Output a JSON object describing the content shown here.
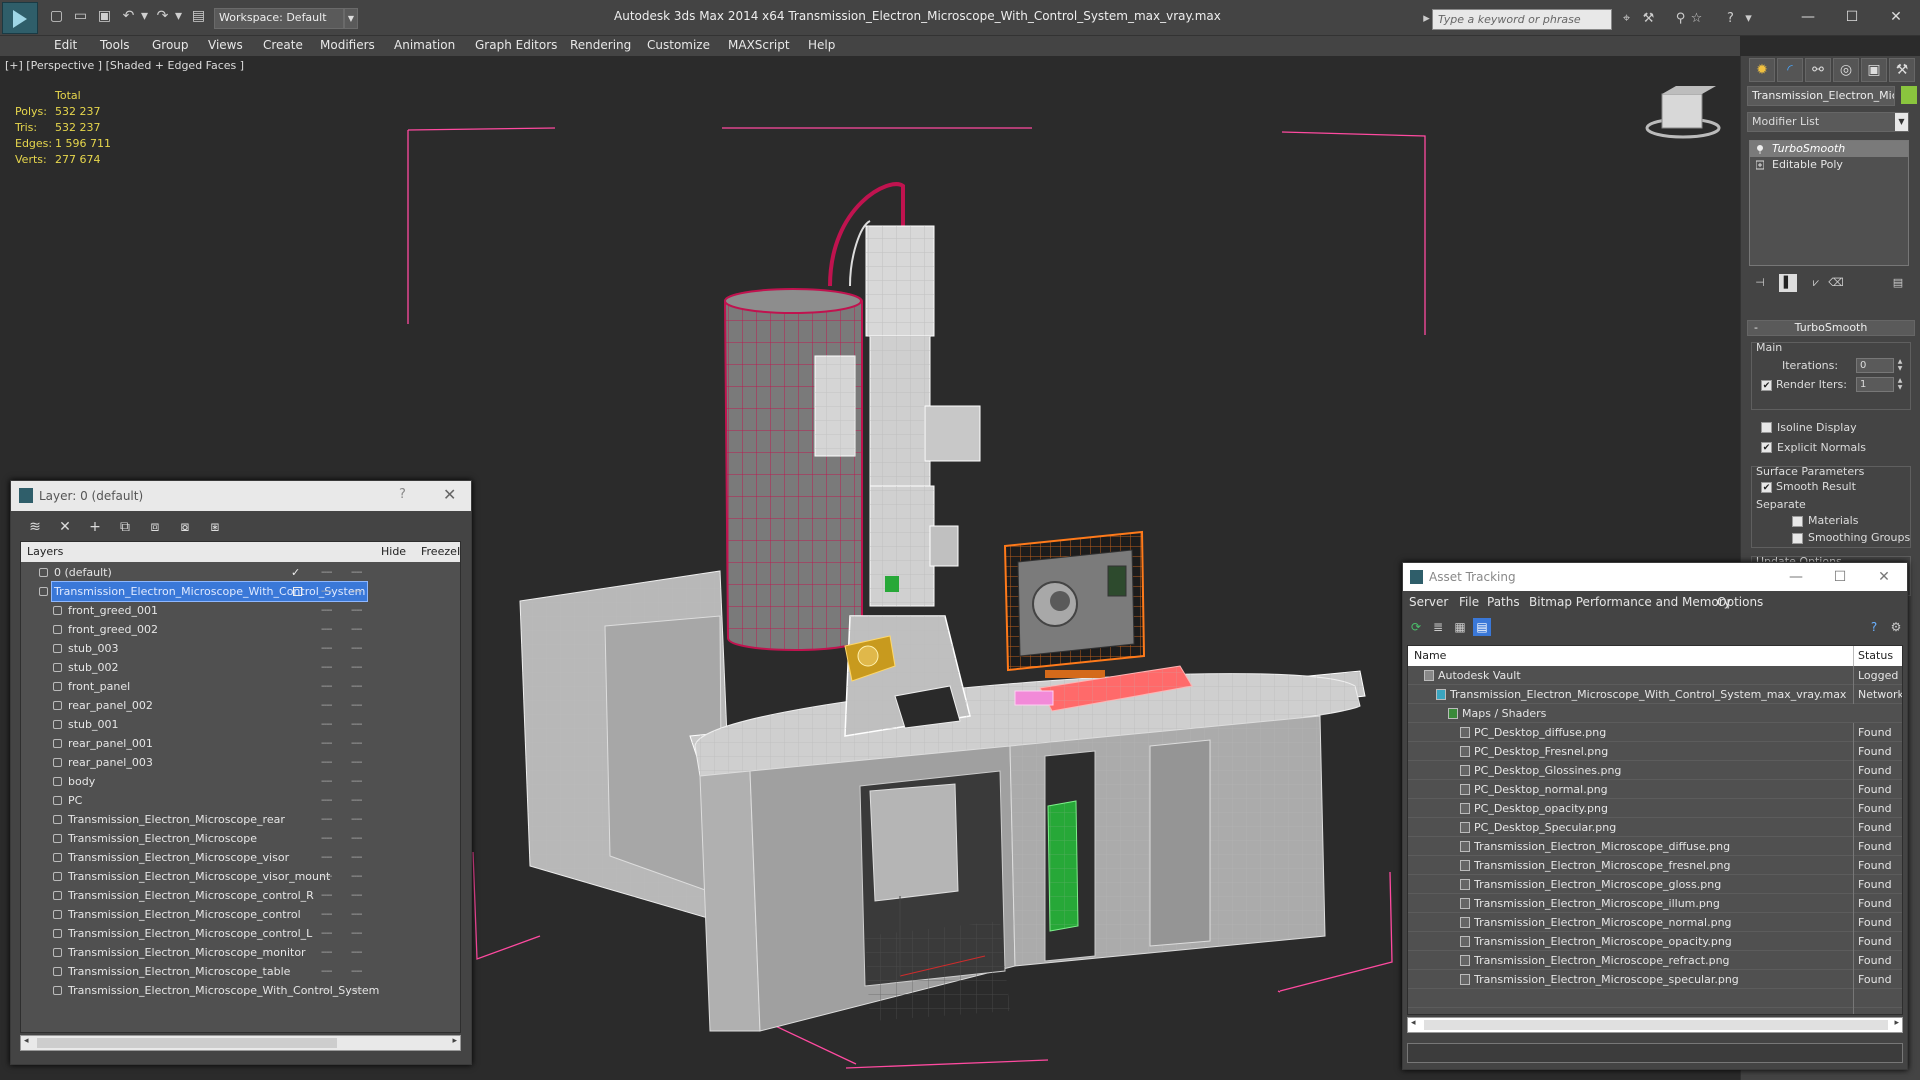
{
  "window": {
    "title": "Autodesk 3ds Max  2014 x64     Transmission_Electron_Microscope_With_Control_System_max_vray.max",
    "workspace": "Workspace: Default",
    "search_placeholder": "Type a keyword or phrase",
    "minimize": "—",
    "maximize": "☐",
    "close": "✕"
  },
  "menu": [
    "Edit",
    "Tools",
    "Group",
    "Views",
    "Create",
    "Modifiers",
    "Animation",
    "Graph Editors",
    "Rendering",
    "Customize",
    "MAXScript",
    "Help"
  ],
  "viewport": {
    "label": "[+] [Perspective ] [Shaded + Edged Faces ]",
    "stats": {
      "header": "Total",
      "rows": [
        {
          "k": "Polys:",
          "v": "532 237"
        },
        {
          "k": "Tris:",
          "v": "532 237"
        },
        {
          "k": "Edges:",
          "v": "1 596 711"
        },
        {
          "k": "Verts:",
          "v": "277 674"
        }
      ]
    },
    "colors": {
      "bbox": "#ff4aa0",
      "case": "#c0134f",
      "monitor": "#ff7a1a",
      "keyboard": "#ff6a6a",
      "pc": "#27a838",
      "knob": "#c89a1e"
    }
  },
  "command_panel": {
    "object_name": "Transmission_Electron_Micros",
    "modifier_list": "Modifier List",
    "stack": [
      "TurboSmooth",
      "Editable Poly"
    ],
    "turbosmooth": {
      "rollout": "TurboSmooth",
      "main": "Main",
      "iterations_label": "Iterations:",
      "iterations": "0",
      "render_iters_label": "Render Iters:",
      "render_iters": "1",
      "isoline": "Isoline Display",
      "explicit": "Explicit Normals",
      "surface": "Surface Parameters",
      "smooth_result": "Smooth Result",
      "separate": "Separate",
      "materials": "Materials",
      "smoothing_groups": "Smoothing Groups",
      "update": "Update Options"
    }
  },
  "layer_dialog": {
    "title": "Layer: 0 (default)",
    "help": "?",
    "close": "✕",
    "header": {
      "layers": "Layers",
      "hide": "Hide",
      "freeze": "Freeze",
      "r": "I"
    },
    "layers": [
      {
        "name": "0 (default)",
        "level": 0
      },
      {
        "name": "Transmission_Electron_Microscope_With_Control_System",
        "level": 0,
        "selected": true
      },
      {
        "name": "front_greed_001",
        "level": 1
      },
      {
        "name": "front_greed_002",
        "level": 1
      },
      {
        "name": "stub_003",
        "level": 1
      },
      {
        "name": "stub_002",
        "level": 1
      },
      {
        "name": "front_panel",
        "level": 1
      },
      {
        "name": "rear_panel_002",
        "level": 1
      },
      {
        "name": "stub_001",
        "level": 1
      },
      {
        "name": "rear_panel_001",
        "level": 1
      },
      {
        "name": "rear_panel_003",
        "level": 1
      },
      {
        "name": "body",
        "level": 1
      },
      {
        "name": "PC",
        "level": 1
      },
      {
        "name": "Transmission_Electron_Microscope_rear",
        "level": 1
      },
      {
        "name": "Transmission_Electron_Microscope",
        "level": 1
      },
      {
        "name": "Transmission_Electron_Microscope_visor",
        "level": 1
      },
      {
        "name": "Transmission_Electron_Microscope_visor_mount",
        "level": 1
      },
      {
        "name": "Transmission_Electron_Microscope_control_R",
        "level": 1
      },
      {
        "name": "Transmission_Electron_Microscope_control",
        "level": 1
      },
      {
        "name": "Transmission_Electron_Microscope_control_L",
        "level": 1
      },
      {
        "name": "Transmission_Electron_Microscope_monitor",
        "level": 1
      },
      {
        "name": "Transmission_Electron_Microscope_table",
        "level": 1
      },
      {
        "name": "Transmission_Electron_Microscope_With_Control_System",
        "level": 1
      }
    ],
    "check": "✓",
    "dash": "----"
  },
  "asset_dialog": {
    "title": "Asset Tracking",
    "menu": [
      "Server",
      "File",
      "Paths",
      "Bitmap Performance and Memory",
      "Options"
    ],
    "header": {
      "name": "Name",
      "status": "Status"
    },
    "rows": [
      {
        "name": "Autodesk Vault",
        "status": "Logged C",
        "level": 0
      },
      {
        "name": "Transmission_Electron_Microscope_With_Control_System_max_vray.max",
        "status": "Network I",
        "level": 1
      },
      {
        "name": "Maps / Shaders",
        "status": "",
        "level": 2
      },
      {
        "name": "PC_Desktop_diffuse.png",
        "status": "Found",
        "level": 3
      },
      {
        "name": "PC_Desktop_Fresnel.png",
        "status": "Found",
        "level": 3
      },
      {
        "name": "PC_Desktop_Glossines.png",
        "status": "Found",
        "level": 3
      },
      {
        "name": "PC_Desktop_normal.png",
        "status": "Found",
        "level": 3
      },
      {
        "name": "PC_Desktop_opacity.png",
        "status": "Found",
        "level": 3
      },
      {
        "name": "PC_Desktop_Specular.png",
        "status": "Found",
        "level": 3
      },
      {
        "name": "Transmission_Electron_Microscope_diffuse.png",
        "status": "Found",
        "level": 3
      },
      {
        "name": "Transmission_Electron_Microscope_fresnel.png",
        "status": "Found",
        "level": 3
      },
      {
        "name": "Transmission_Electron_Microscope_gloss.png",
        "status": "Found",
        "level": 3
      },
      {
        "name": "Transmission_Electron_Microscope_illum.png",
        "status": "Found",
        "level": 3
      },
      {
        "name": "Transmission_Electron_Microscope_normal.png",
        "status": "Found",
        "level": 3
      },
      {
        "name": "Transmission_Electron_Microscope_opacity.png",
        "status": "Found",
        "level": 3
      },
      {
        "name": "Transmission_Electron_Microscope_refract.png",
        "status": "Found",
        "level": 3
      },
      {
        "name": "Transmission_Electron_Microscope_specular.png",
        "status": "Found",
        "level": 3
      }
    ]
  }
}
